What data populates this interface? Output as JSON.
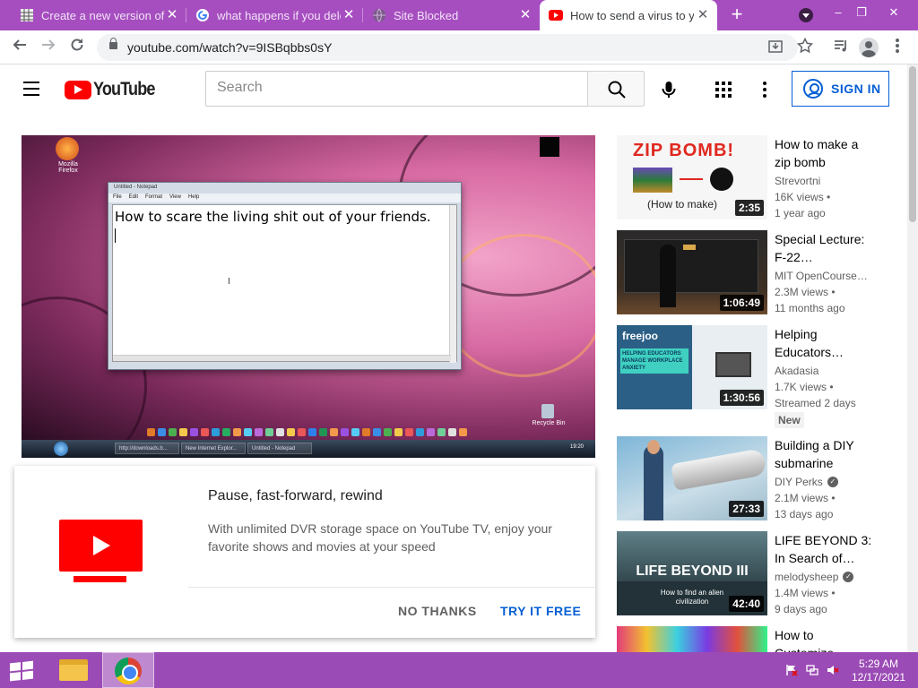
{
  "browser": {
    "tabs": [
      {
        "title": "Create a new version of p",
        "icon": "spreadsheet-icon",
        "active": false
      },
      {
        "title": "what happens if you dele",
        "icon": "google-icon",
        "active": false
      },
      {
        "title": "Site Blocked",
        "icon": "globe-icon",
        "active": false
      },
      {
        "title": "How to send a virus to yo",
        "icon": "youtube-icon",
        "active": true
      }
    ],
    "new_tab": "+",
    "window_controls": {
      "minimize": "–",
      "restore": "❐",
      "close": "✕"
    },
    "url": "youtube.com/watch?v=9ISBqbbs0sY"
  },
  "youtube": {
    "logo_text": "YouTube",
    "search_placeholder": "Search",
    "sign_in": "SIGN IN"
  },
  "video": {
    "notepad_title": "Untitled - Notepad",
    "notepad_menu": [
      "File",
      "Edit",
      "Format",
      "View",
      "Help"
    ],
    "notepad_text": "How to scare the living shit out of your friends.",
    "desktop_icons": [
      {
        "label": "Mozilla Firefox"
      },
      {
        "label": "Recycle Bin"
      }
    ],
    "taskbar_items": [
      "http://downloads.b...",
      "New Internet Explor...",
      "Untitled - Notepad"
    ],
    "clock": "19:20"
  },
  "promo": {
    "title": "Pause, fast-forward, rewind",
    "text": "With unlimited DVR storage space on YouTube TV, enjoy your favorite shows and movies at your speed",
    "no_thanks": "NO THANKS",
    "try_free": "TRY IT FREE"
  },
  "related": [
    {
      "title": "How to make a zip bomb",
      "channel": "Strevortni",
      "verified": false,
      "views": "16K views •",
      "age": "1 year ago",
      "duration": "2:35",
      "badge": "",
      "thumb_text": "ZIP BOMB!",
      "thumb_sub": "(How to make)"
    },
    {
      "title": "Special Lecture: F-22…",
      "channel": "MIT OpenCourse…",
      "verified": false,
      "views": "2.3M views •",
      "age": "11 months ago",
      "duration": "1:06:49",
      "badge": "",
      "thumb_text": "",
      "thumb_sub": ""
    },
    {
      "title": "Helping Educators…",
      "channel": "Akadasia",
      "verified": false,
      "views": "1.7K views •",
      "age": "Streamed 2 days",
      "duration": "1:30:56",
      "badge": "New",
      "thumb_text": "freejoo",
      "thumb_sub": "HELPING EDUCATORS MANAGE WORKPLACE ANXIETY"
    },
    {
      "title": "Building a DIY submarine",
      "channel": "DIY Perks",
      "verified": true,
      "views": "2.1M views •",
      "age": "13 days ago",
      "duration": "27:33",
      "badge": "",
      "thumb_text": "",
      "thumb_sub": ""
    },
    {
      "title": "LIFE BEYOND 3: In Search of…",
      "channel": "melodysheep",
      "verified": true,
      "views": "1.4M views •",
      "age": "9 days ago",
      "duration": "42:40",
      "badge": "",
      "thumb_text": "LIFE BEYOND III",
      "thumb_sub": "How to find an alien civilization"
    },
    {
      "title": "How to Customize",
      "channel": "",
      "verified": false,
      "views": "",
      "age": "",
      "duration": "",
      "badge": "",
      "thumb_text": "",
      "thumb_sub": ""
    }
  ],
  "taskbar": {
    "time": "5:29 AM",
    "date": "12/17/2021"
  },
  "colors": {
    "chrome_frame": "#a64ec0",
    "taskbar": "#9b4bb5",
    "youtube_red": "#ff0000",
    "link_blue": "#065fd4"
  }
}
